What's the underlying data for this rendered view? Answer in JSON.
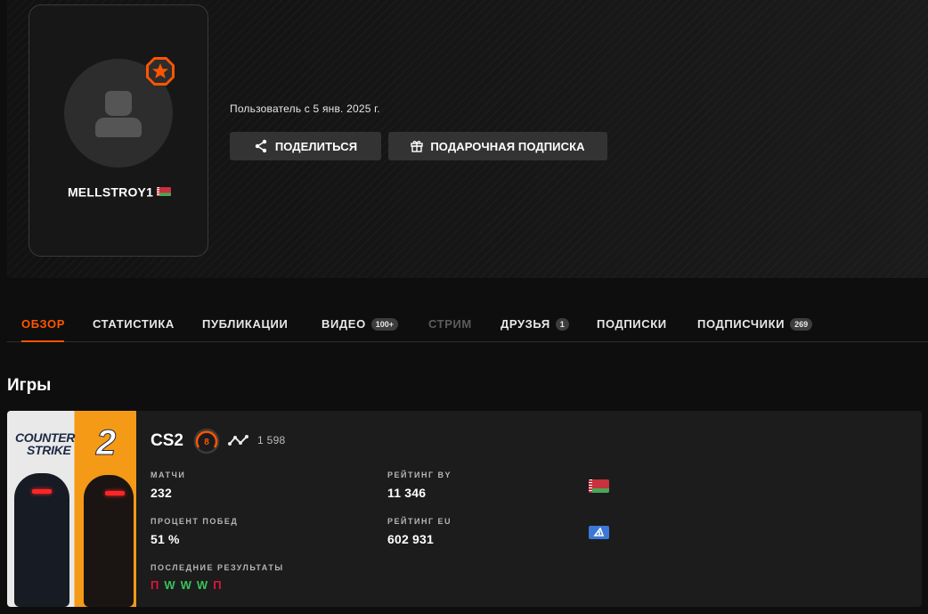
{
  "profile": {
    "username": "MELLSTROY1",
    "member_since": "Пользователь с 5 янв. 2025 г.",
    "country_flag": "belarus-flag-icon"
  },
  "actions": {
    "share_label": "ПОДЕЛИТЬСЯ",
    "gift_label": "ПОДАРОЧНАЯ ПОДПИСКА"
  },
  "tabs": {
    "overview": "ОБЗОР",
    "stats": "СТАТИСТИКА",
    "posts": "ПУБЛИКАЦИИ",
    "videos": "ВИДЕО",
    "videos_count": "100+",
    "stream": "СТРИМ",
    "friends": "ДРУЗЬЯ",
    "friends_count": "1",
    "subscriptions": "ПОДПИСКИ",
    "subscribers": "ПОДПИСЧИКИ",
    "subscribers_count": "269"
  },
  "games": {
    "section_title": "Игры",
    "cs2": {
      "cover_logo_line1": "COUNTER",
      "cover_logo_line2": "STRIKE",
      "cover_logo_num": "2",
      "name": "CS2",
      "level": "8",
      "elo": "1 598",
      "matches_label": "МАТЧИ",
      "matches_value": "232",
      "winrate_label": "ПРОЦЕНТ ПОБЕД",
      "winrate_value": "51 %",
      "recent_label": "ПОСЛЕДНИЕ РЕЗУЛЬТАТЫ",
      "recent_results": [
        "П",
        "W",
        "W",
        "W",
        "П"
      ],
      "rating_by_label": "РЕЙТИНГ BY",
      "rating_by_value": "11 346",
      "rating_eu_label": "РЕЙТИНГ EU",
      "rating_eu_value": "602 931"
    }
  },
  "colors": {
    "accent": "#ff5500",
    "win": "#39c25a",
    "loss": "#e0143c"
  }
}
